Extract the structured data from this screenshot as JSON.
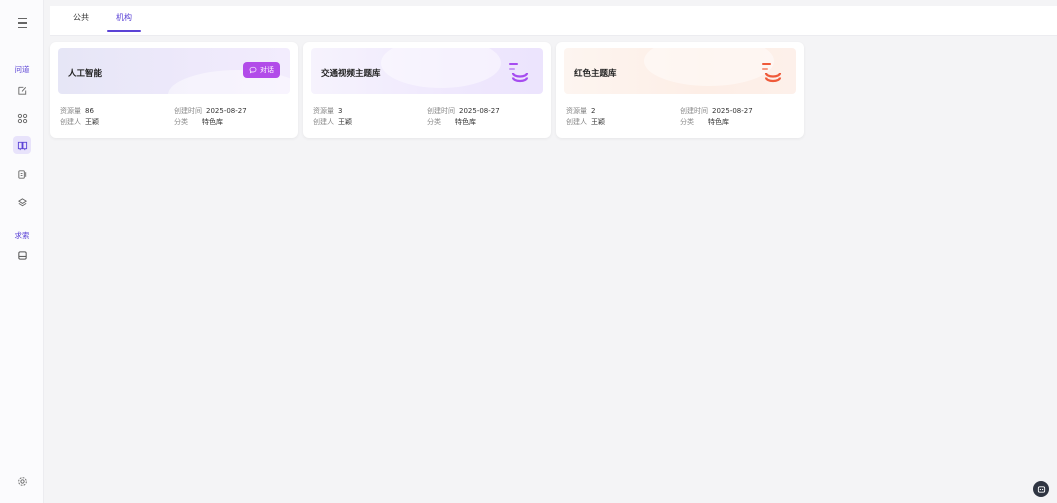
{
  "sidebar": {
    "section_1": "问道",
    "section_2": "求索",
    "icons": [
      "menu-icon",
      "edit-icon",
      "grid-icon",
      "book-icon",
      "document-icon",
      "layers-icon",
      "archive-icon",
      "settings-icon"
    ]
  },
  "tabs": [
    {
      "label": "公共",
      "active": false
    },
    {
      "label": "机构",
      "active": true
    }
  ],
  "labels": {
    "resource_count": "资源量",
    "creator": "创建人",
    "created_time": "创建时间",
    "category": "分类"
  },
  "cards": [
    {
      "title": "人工智能",
      "resource_count": "86",
      "creator": "王颖",
      "created_time": "2025-08-27",
      "category": "特色库",
      "chat_label": "对话",
      "theme": "purple"
    },
    {
      "title": "交通视频主题库",
      "resource_count": "3",
      "creator": "王颖",
      "created_time": "2025-08-27",
      "category": "特色库",
      "theme": "lilac"
    },
    {
      "title": "红色主题库",
      "resource_count": "2",
      "creator": "王颖",
      "created_time": "2025-08-27",
      "category": "特色库",
      "theme": "peach"
    }
  ],
  "colors": {
    "accent": "#5b43d6",
    "chat_button": "#b24ce9",
    "db_purple": "#a64df0",
    "db_red": "#ef5a3a"
  }
}
